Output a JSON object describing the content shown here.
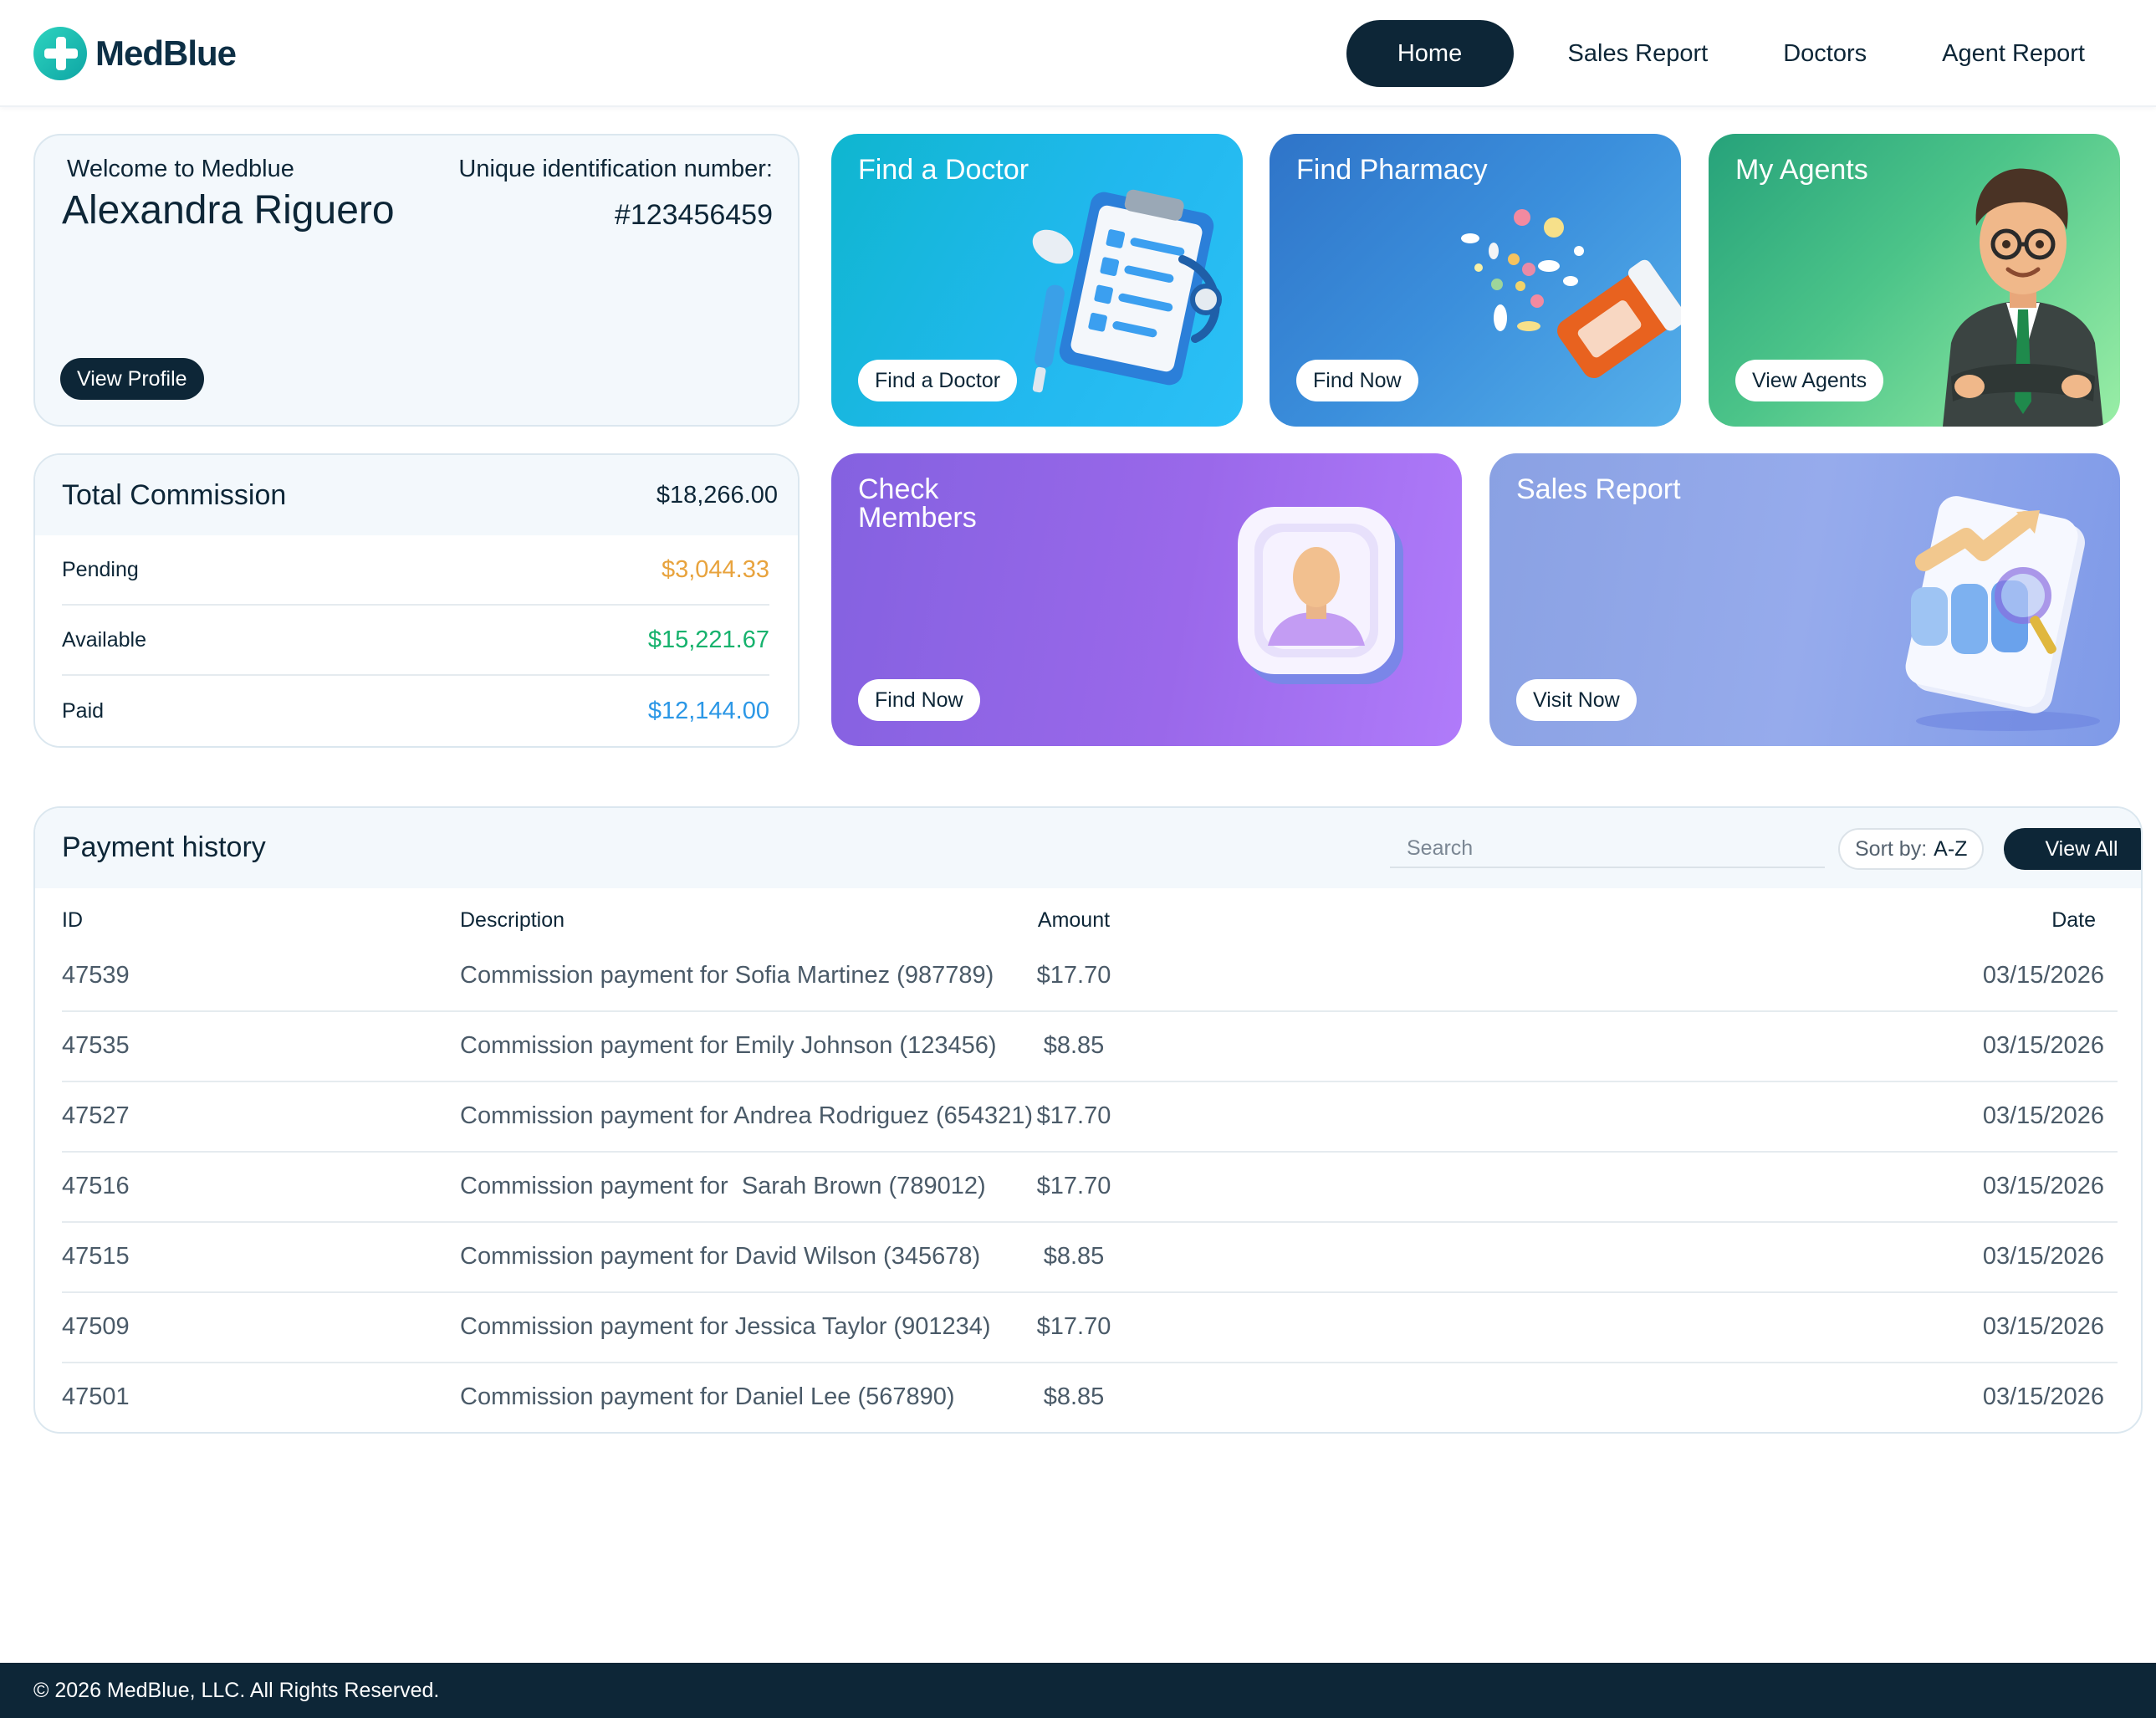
{
  "app": {
    "name": "MedBlue"
  },
  "nav": {
    "items": [
      "Home",
      "Sales Report",
      "Doctors",
      "Agent Report"
    ],
    "active": "Home"
  },
  "welcome": {
    "greeting": "Welcome to Medblue",
    "name": "Alexandra Riguero",
    "uid_label": "Unique identification number:",
    "uid": "#123456459",
    "profile_button": "View Profile"
  },
  "commission": {
    "title": "Total Commission",
    "total": "$18,266.00",
    "rows": [
      {
        "label": "Pending",
        "value": "$3,044.33",
        "color": "#e8a33d"
      },
      {
        "label": "Available",
        "value": "$15,221.67",
        "color": "#16b26d"
      },
      {
        "label": "Paid",
        "value": "$12,144.00",
        "color": "#2b97e6"
      }
    ]
  },
  "tiles": {
    "doctor": {
      "title": "Find a Doctor",
      "button": "Find a Doctor"
    },
    "pharmacy": {
      "title": "Find Pharmacy",
      "button": "Find Now"
    },
    "agents": {
      "title": "My Agents",
      "button": "View Agents"
    },
    "members": {
      "title_line1": "Check",
      "title_line2": "Members",
      "button": "Find Now"
    },
    "sales": {
      "title": "Sales Report",
      "button": "Visit Now"
    }
  },
  "payments": {
    "title": "Payment history",
    "search_placeholder": "Search",
    "sort_label": "Sort by:",
    "sort_value": "A-Z",
    "view_all": "View All",
    "columns": [
      "ID",
      "Description",
      "Amount",
      "Date"
    ],
    "rows": [
      {
        "id": "47539",
        "description": "Commission payment for Sofia Martinez (987789)",
        "amount": "$17.70",
        "date": "03/15/2026"
      },
      {
        "id": "47535",
        "description": "Commission payment for Emily Johnson (123456)",
        "amount": "$8.85",
        "date": "03/15/2026"
      },
      {
        "id": "47527",
        "description": "Commission payment for Andrea Rodriguez (654321)",
        "amount": "$17.70",
        "date": "03/15/2026"
      },
      {
        "id": "47516",
        "description": "Commission payment for  Sarah Brown (789012)",
        "amount": "$17.70",
        "date": "03/15/2026"
      },
      {
        "id": "47515",
        "description": "Commission payment for David Wilson (345678)",
        "amount": "$8.85",
        "date": "03/15/2026"
      },
      {
        "id": "47509",
        "description": "Commission payment for Jessica Taylor (901234)",
        "amount": "$17.70",
        "date": "03/15/2026"
      },
      {
        "id": "47501",
        "description": "Commission payment for Daniel Lee (567890)",
        "amount": "$8.85",
        "date": "03/15/2026"
      }
    ]
  },
  "footer": {
    "text": "© 2026 MedBlue, LLC. All Rights Reserved."
  },
  "icons": [
    "medical-cross-logo-icon",
    "clipboard-illustration-icon",
    "pills-illustration-icon",
    "agent-avatar-illustration-icon",
    "member-profile-illustration-icon",
    "sales-chart-illustration-icon"
  ],
  "colors": {
    "brand_dark": "#0d2637",
    "brand_teal": "#14b8a6",
    "pending": "#e8a33d",
    "available": "#16b26d",
    "paid": "#2b97e6"
  }
}
